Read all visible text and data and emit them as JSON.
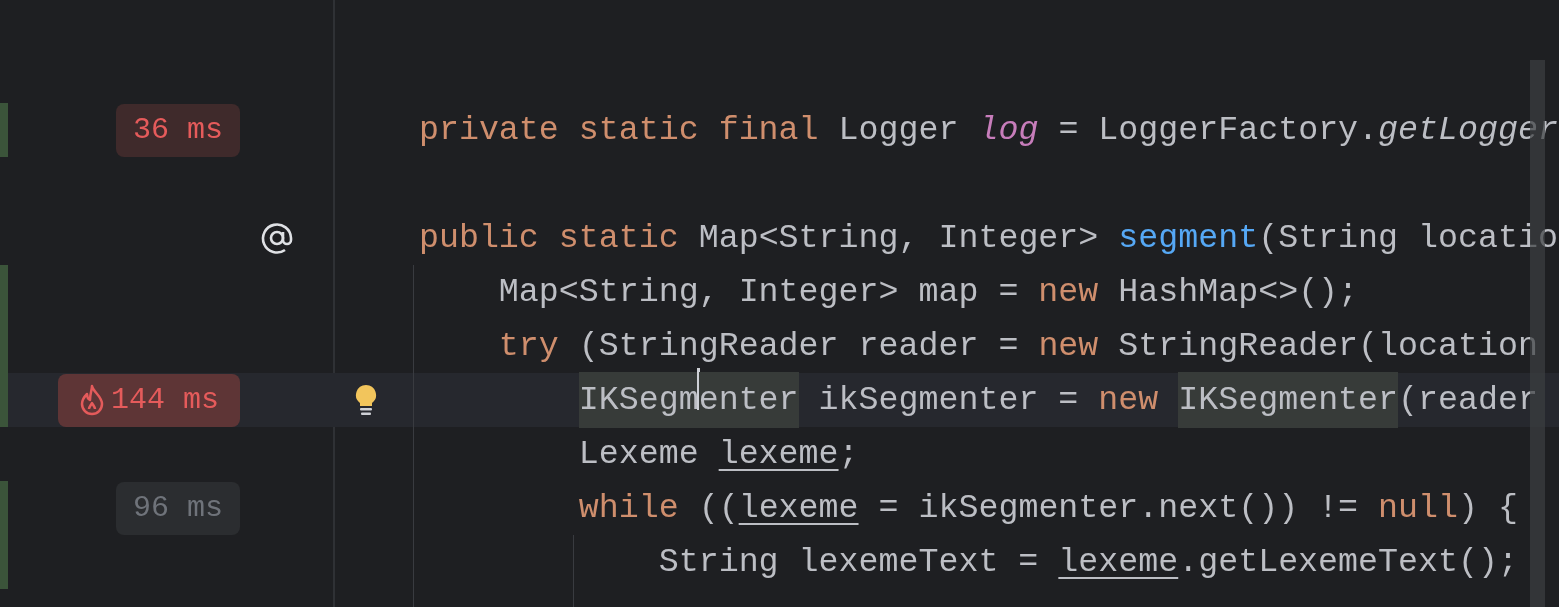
{
  "editor": {
    "lines": [
      {
        "changed": true,
        "current": false,
        "timing": {
          "text": "36 ms",
          "kind": "slow"
        },
        "tokens": [
          {
            "text": "    private static final",
            "kind": "keyword"
          },
          {
            "text": " Logger "
          },
          {
            "text": "log",
            "kind": "field"
          },
          {
            "text": " = LoggerFactory."
          },
          {
            "text": "getLogger",
            "kind": "static_call"
          }
        ]
      },
      {
        "changed": false,
        "current": false
      },
      {
        "changed": false,
        "current": false,
        "gutter": {
          "kind": "annotation"
        },
        "tokens": [
          {
            "text": "    public static",
            "kind": "keyword"
          },
          {
            "text": " Map<String, Integer> "
          },
          {
            "text": "segment",
            "kind": "method_decl"
          },
          {
            "text": "(String locatio"
          }
        ]
      },
      {
        "changed": true,
        "current": false,
        "tokens": [
          {
            "text": "        Map<String, Integer> map = "
          },
          {
            "text": "new",
            "kind": "keyword"
          },
          {
            "text": " HashMap<>();"
          }
        ]
      },
      {
        "changed": true,
        "current": false,
        "tokens": [
          {
            "text": "        try",
            "kind": "keyword"
          },
          {
            "text": " (StringReader reader = "
          },
          {
            "text": "new",
            "kind": "keyword"
          },
          {
            "text": " StringReader(location"
          }
        ]
      },
      {
        "changed": true,
        "current": true,
        "timing": {
          "text": "144 ms",
          "kind": "hot"
        },
        "gutter": {
          "kind": "bulb"
        },
        "tokens": [
          {
            "text": "            IKSegm",
            "highlighted": true,
            "caret_after": true
          },
          {
            "text": "enter",
            "highlighted": true
          },
          {
            "text": " ikSegmenter = "
          },
          {
            "text": "new ",
            "kind": "keyword"
          },
          {
            "text": "IKSegmenter",
            "highlighted": true
          },
          {
            "text": "(reader"
          }
        ]
      },
      {
        "changed": false,
        "current": false,
        "tokens": [
          {
            "text": "            Lexeme "
          },
          {
            "text": "lexeme",
            "underlined": true
          },
          {
            "text": ";"
          }
        ]
      },
      {
        "changed": true,
        "current": false,
        "timing": {
          "text": "96 ms",
          "kind": "normal"
        },
        "tokens": [
          {
            "text": "            while",
            "kind": "keyword"
          },
          {
            "text": " (("
          },
          {
            "text": "lexeme",
            "underlined": true
          },
          {
            "text": " = ikSegmenter.next()) != "
          },
          {
            "text": "null",
            "kind": "keyword"
          },
          {
            "text": ") {"
          }
        ]
      },
      {
        "changed": true,
        "current": false,
        "tokens": [
          {
            "text": "                String lexemeText = "
          },
          {
            "text": "lexeme",
            "underlined": true
          },
          {
            "text": ".getLexemeText();"
          }
        ]
      }
    ]
  }
}
